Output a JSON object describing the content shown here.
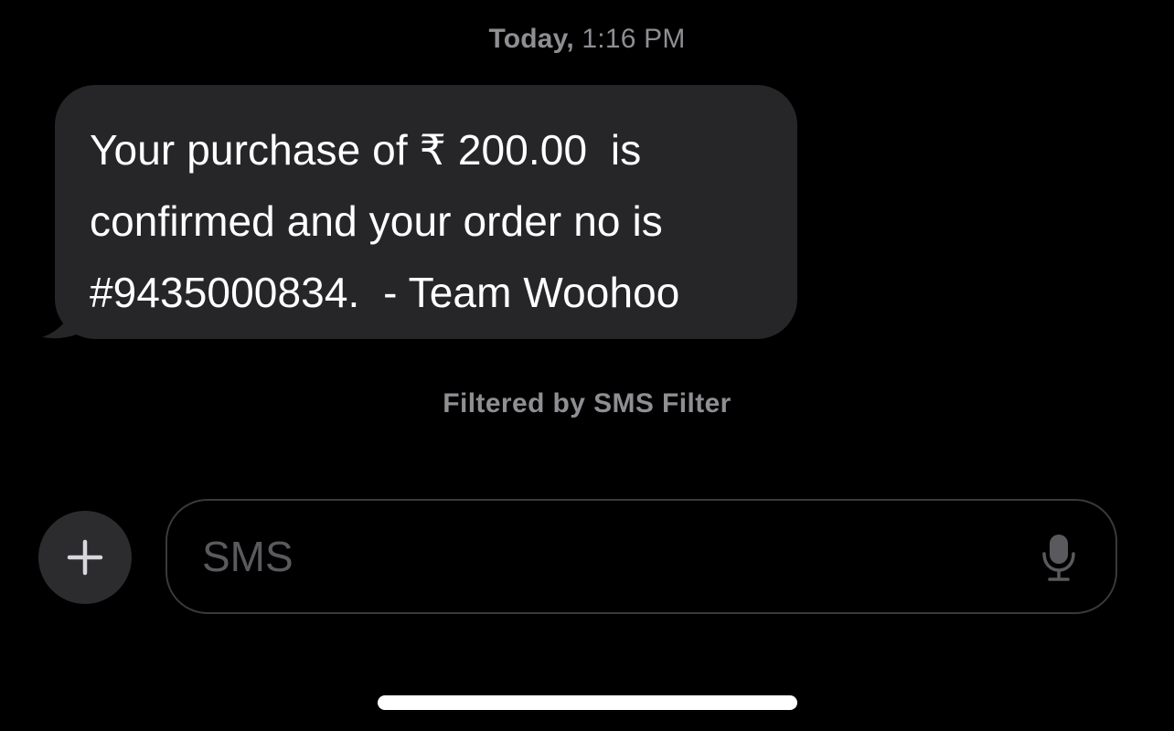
{
  "conversation": {
    "timestamp_day": "Today,",
    "timestamp_time": "1:16 PM",
    "messages": [
      {
        "direction": "incoming",
        "text": "Your purchase of ₹ 200.00  is\nconfirmed and your order no is\n#9435000834.  - Team Woohoo"
      }
    ],
    "filter_note": "Filtered by SMS Filter"
  },
  "composer": {
    "placeholder": "SMS",
    "value": "",
    "add_icon": "plus-icon",
    "mic_icon": "microphone-icon"
  },
  "colors": {
    "background": "#000000",
    "incoming_bubble": "#262628",
    "secondary_text": "#8e8e93",
    "placeholder_text": "#5a5a5e"
  }
}
